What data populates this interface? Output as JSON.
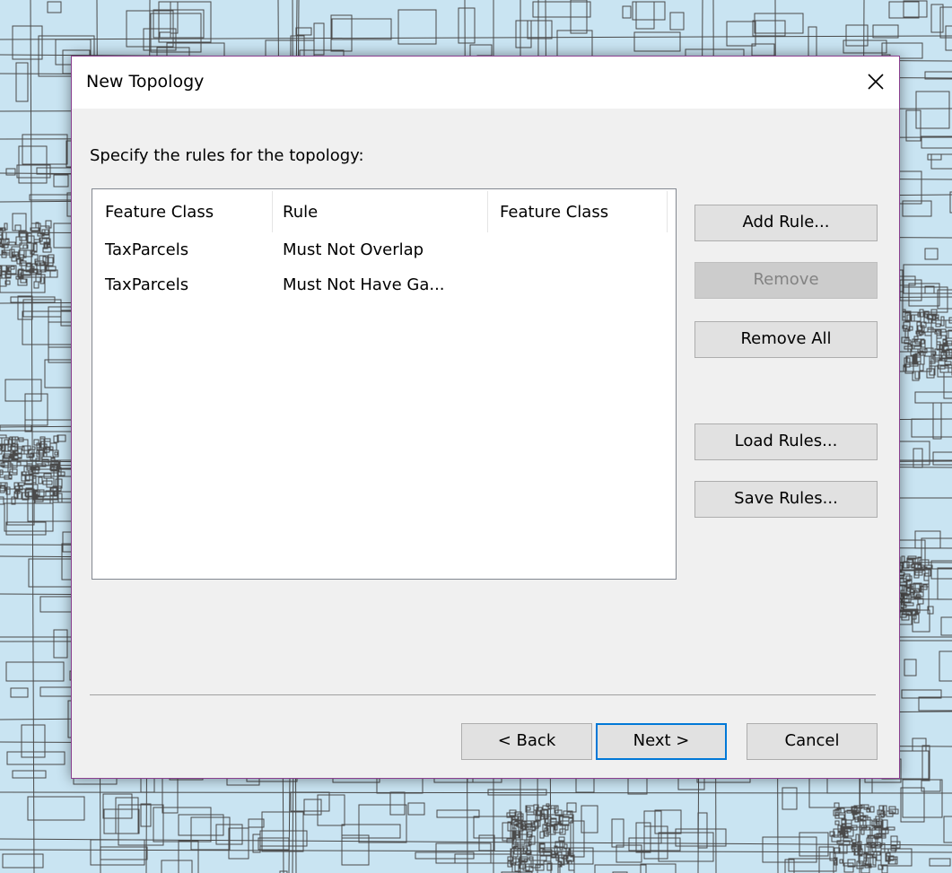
{
  "dialog": {
    "title": "New Topology",
    "close_icon": "close-icon"
  },
  "instruction": "Specify the rules for the topology:",
  "rules_list": {
    "columns": [
      "Feature Class",
      "Rule",
      "Feature Class"
    ],
    "rows": [
      [
        "TaxParcels",
        "Must Not Overlap",
        ""
      ],
      [
        "TaxParcels",
        "Must Not Have Ga...",
        ""
      ]
    ]
  },
  "side_buttons": {
    "add_rule": "Add Rule...",
    "remove": "Remove",
    "remove_all": "Remove All",
    "load_rules": "Load Rules...",
    "save_rules": "Save Rules..."
  },
  "footer_buttons": {
    "back": "< Back",
    "next": "Next >",
    "cancel": "Cancel"
  },
  "colors": {
    "dialog_border": "#8b3f8f",
    "default_button_border": "#0078d7",
    "map_background": "#c9e4f2",
    "map_lines": "#4a4a4a"
  }
}
